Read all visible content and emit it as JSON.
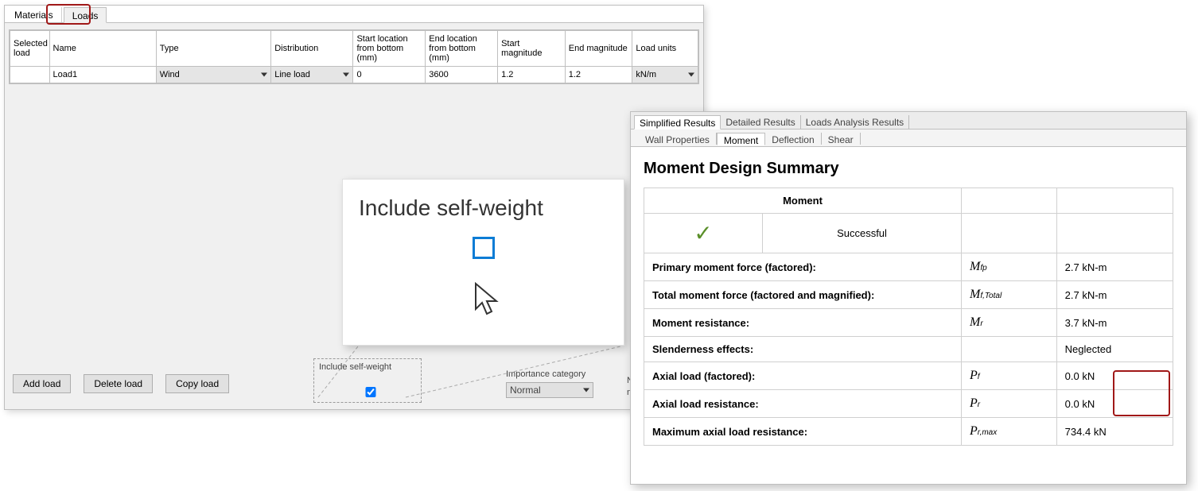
{
  "left": {
    "tabs": [
      "Materials",
      "Loads"
    ],
    "columns": [
      "Selected load",
      "Name",
      "Type",
      "Distribution",
      "Start location from bottom (mm)",
      "End location from bottom (mm)",
      "Start magnitude",
      "End magnitude",
      "Load units"
    ],
    "row": {
      "name": "Load1",
      "type": "Wind",
      "dist": "Line load",
      "startLoc": "0",
      "endLoc": "3600",
      "startMag": "1.2",
      "endMag": "1.2",
      "units": "kN/m"
    },
    "buttons": [
      "Add load",
      "Delete load",
      "Copy load"
    ],
    "selfWeightLabel": "Include self-weight",
    "importanceLabel": "Importance category",
    "importanceValue": "Normal",
    "nbccNote": "NBCC applied. Do not"
  },
  "callout": {
    "title": "Include self-weight"
  },
  "results": {
    "tabs1": [
      "Simplified Results",
      "Detailed Results",
      "Loads Analysis Results"
    ],
    "tabs2": [
      "Wall Properties",
      "Moment",
      "Deflection",
      "Shear"
    ],
    "heading": "Moment Design Summary",
    "momentHdr": "Moment",
    "status": "Successful",
    "rows": [
      {
        "label": "Primary moment force (factored):",
        "sym": "M",
        "sub": "fp",
        "val": "2.7 kN-m"
      },
      {
        "label": "Total moment force (factored and magnified):",
        "sym": "M",
        "sub": "f,Total",
        "val": "2.7 kN-m"
      },
      {
        "label": "Moment resistance:",
        "sym": "M",
        "sub": "r",
        "val": "3.7 kN-m"
      },
      {
        "label": "Slenderness effects:",
        "sym": "",
        "sub": "",
        "val": "Neglected"
      },
      {
        "label": "Axial load (factored):",
        "sym": "P",
        "sub": "f",
        "val": "0.0 kN"
      },
      {
        "label": "Axial load resistance:",
        "sym": "P",
        "sub": "r",
        "val": "0.0 kN"
      },
      {
        "label": "Maximum axial load resistance:",
        "sym": "P",
        "sub": "r,max",
        "val": "734.4 kN"
      }
    ]
  }
}
